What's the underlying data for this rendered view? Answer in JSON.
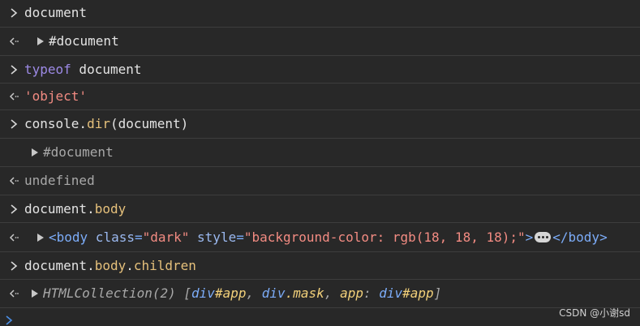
{
  "console": {
    "rows": [
      {
        "kind": "input",
        "text": "document"
      },
      {
        "kind": "output",
        "expander": "#document"
      },
      {
        "kind": "input",
        "keyword": "typeof",
        "text": " document"
      },
      {
        "kind": "output",
        "string": "'object'"
      },
      {
        "kind": "input",
        "obj": "console.",
        "method": "dir",
        "args": "(document)"
      },
      {
        "kind": "log",
        "expander": "#document"
      },
      {
        "kind": "output",
        "text": "undefined"
      },
      {
        "kind": "input",
        "obj": "document.",
        "prop": "body"
      },
      {
        "kind": "output",
        "tag_open": "<body",
        "attr1_name": " class",
        "eq1": "=",
        "attr1_val": "\"dark\"",
        "attr2_name": " style",
        "eq2": "=",
        "attr2_val": "\"background-color: rgb(18, 18, 18);\"",
        "tag_close_bracket": ">",
        "tag_end": "</body>"
      },
      {
        "kind": "input",
        "obj": "document.",
        "prop1": "body",
        "dot": ".",
        "prop2": "children"
      },
      {
        "kind": "output",
        "collection": "HTMLCollection(2)",
        "open": " [",
        "item1_tag": "div",
        "item1_id": "#app",
        "sep1": ", ",
        "item2_tag": "div",
        "item2_class": ".mask",
        "sep2": ", ",
        "item3_key": "app",
        "colon": ": ",
        "item3_tag": "div",
        "item3_id": "#app",
        "close": "]"
      }
    ]
  },
  "watermark": "CSDN @小谢sd",
  "colors": {
    "background": "#282828",
    "divider": "#3d3d3d",
    "keyword": "#9d8ae6",
    "string": "#f28b82",
    "property": "#e5c07b",
    "tag": "#7cacf8"
  }
}
